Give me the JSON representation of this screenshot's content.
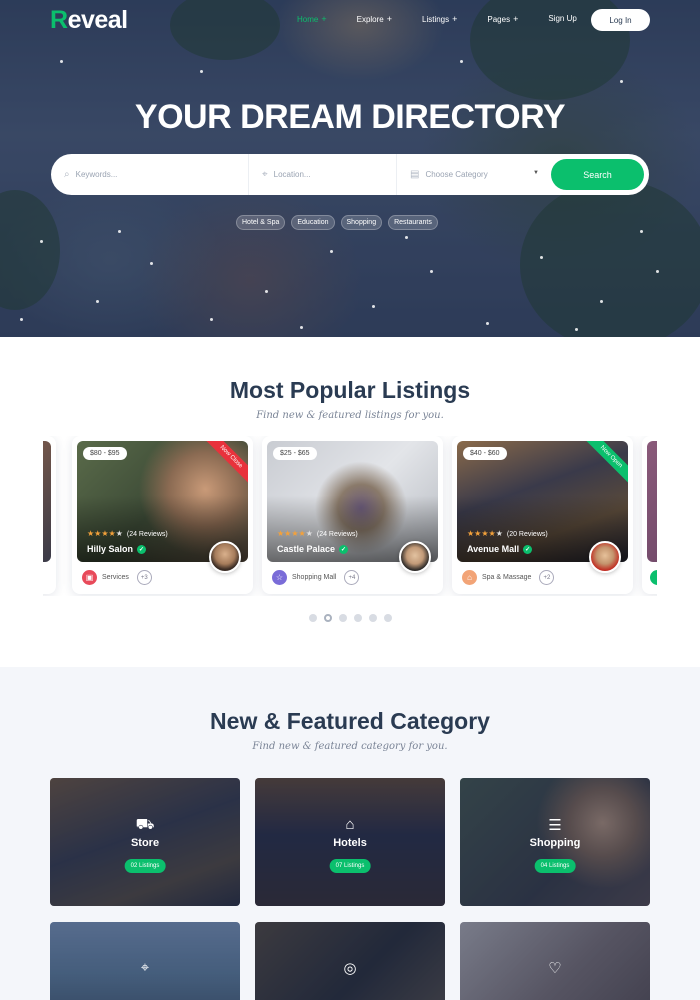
{
  "brand": {
    "logo_initial": "R",
    "logo_rest": "eveal"
  },
  "nav": {
    "items": [
      {
        "label": "Home",
        "plus": "+",
        "active": true
      },
      {
        "label": "Explore",
        "plus": "+"
      },
      {
        "label": "Listings",
        "plus": "+"
      },
      {
        "label": "Pages",
        "plus": "+"
      },
      {
        "label": "Sign Up",
        "plus": ""
      }
    ],
    "login_label": "Log In"
  },
  "hero": {
    "title": "YOUR DREAM DIRECTORY",
    "search": {
      "keywords_placeholder": "Keywords...",
      "location_placeholder": "Location...",
      "category_placeholder": "Choose Category",
      "button_label": "Search"
    },
    "tags": [
      "Hotel & Spa",
      "Education",
      "Shopping",
      "Restaurants"
    ]
  },
  "listings_section": {
    "title": "Most Popular Listings",
    "subtitle": "Find new & featured listings for you.",
    "cards": [
      {
        "price": "$80 - $95",
        "reviews": "(24 Reviews)",
        "name": "Hilly Salon",
        "category": "Services",
        "more": "+3",
        "ribbon": "Now Close",
        "ribbon_color": "#e8323c",
        "category_color": "#e84a5a",
        "rating": 4
      },
      {
        "price": "$25 - $65",
        "reviews": "(24 Reviews)",
        "name": "Castle Palace",
        "category": "Shopping Mall",
        "more": "+4",
        "ribbon": "",
        "category_color": "#7a6cd8",
        "rating": 4
      },
      {
        "price": "$40 - $60",
        "reviews": "(20 Reviews)",
        "name": "Avenue Mall",
        "category": "Spa & Massage",
        "more": "+2",
        "ribbon": "Now Open",
        "ribbon_color": "#0bbf6d",
        "category_color": "#f2a477",
        "rating": 4
      }
    ],
    "pager": {
      "total": 6,
      "active_index": 1
    }
  },
  "categories_section": {
    "title": "New & Featured Category",
    "subtitle": "Find new & featured category for you.",
    "tiles": [
      {
        "name": "Store",
        "count": "02 Listings",
        "icon": "truck-icon"
      },
      {
        "name": "Hotels",
        "count": "07 Listings",
        "icon": "building-icon"
      },
      {
        "name": "Shopping",
        "count": "04 Listings",
        "icon": "cart-icon"
      },
      {
        "name": "",
        "count": "",
        "icon": "map-pin-icon"
      },
      {
        "name": "",
        "count": "",
        "icon": "burger-icon"
      },
      {
        "name": "",
        "count": "",
        "icon": "heart-icon"
      }
    ]
  },
  "colors": {
    "accent": "#0bbf6d",
    "heading": "#2a3b52"
  }
}
